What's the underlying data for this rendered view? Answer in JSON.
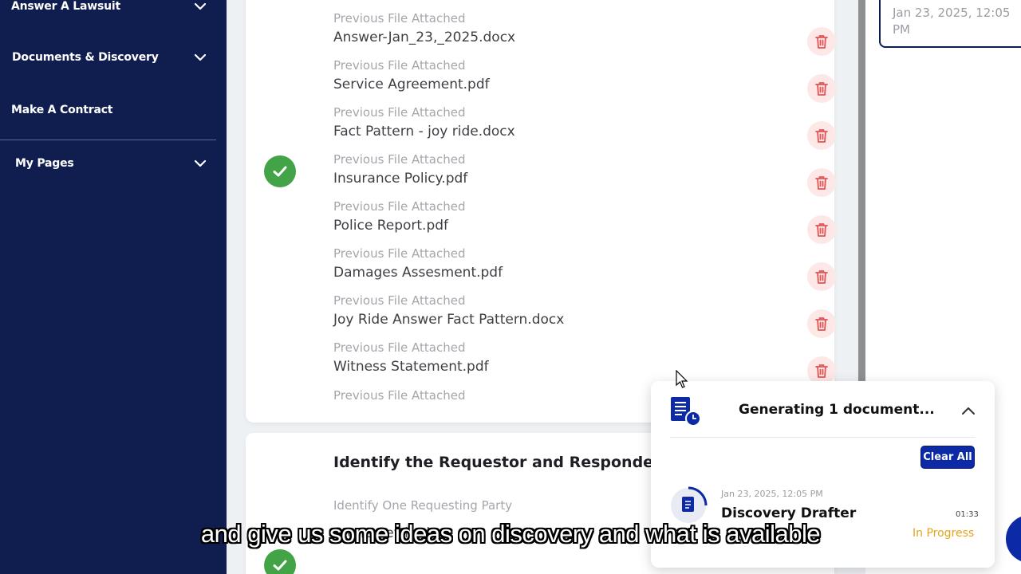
{
  "sidebar": {
    "items": [
      {
        "label": "Answer A Lawsuit",
        "expandable": true
      },
      {
        "label": "Documents & Discovery",
        "expandable": true
      },
      {
        "label": "Make A Contract",
        "expandable": false
      },
      {
        "label": "My Pages",
        "expandable": true
      }
    ]
  },
  "files": {
    "sub_label": "Previous File Attached",
    "items": [
      {
        "sub": "Previous File Attached",
        "name": "Answer-Jan_23,_2025.docx"
      },
      {
        "sub": "Previous File Attached",
        "name": "Service Agreement.pdf"
      },
      {
        "sub": "Previous File Attached",
        "name": "Fact Pattern - joy ride.docx"
      },
      {
        "sub": "Previous File Attached",
        "name": "Insurance Policy.pdf"
      },
      {
        "sub": "Previous File Attached",
        "name": "Police Report.pdf"
      },
      {
        "sub": "Previous File Attached",
        "name": "Damages Assesment.pdf"
      },
      {
        "sub": "Previous File Attached",
        "name": "Joy Ride Answer Fact Pattern.docx"
      },
      {
        "sub": "Previous File Attached",
        "name": "Witness Statement.pdf"
      },
      {
        "sub": "Previous File Attached",
        "name": ""
      }
    ]
  },
  "section2": {
    "heading": "Identify the Requestor and Responder",
    "sub": "Identify One Requesting Party",
    "partial_text": "Stone Settle that"
  },
  "right_panel": {
    "date_text": "Jan 23, 2025, 12:05 PM"
  },
  "popup": {
    "title": "Generating 1 document...",
    "clear_label": "Clear All",
    "job": {
      "date": "Jan 23, 2025, 12:05 PM",
      "title": "Discovery Drafter",
      "elapsed": "01:33",
      "status": "In Progress"
    }
  },
  "subtitle": "and give us some ideas on discovery and what is available",
  "colors": {
    "sidebar": "#0f1e4e",
    "success": "#43a347",
    "danger": "#e05555",
    "accent": "#0c2aa6",
    "status_progress": "#e8a31c"
  }
}
